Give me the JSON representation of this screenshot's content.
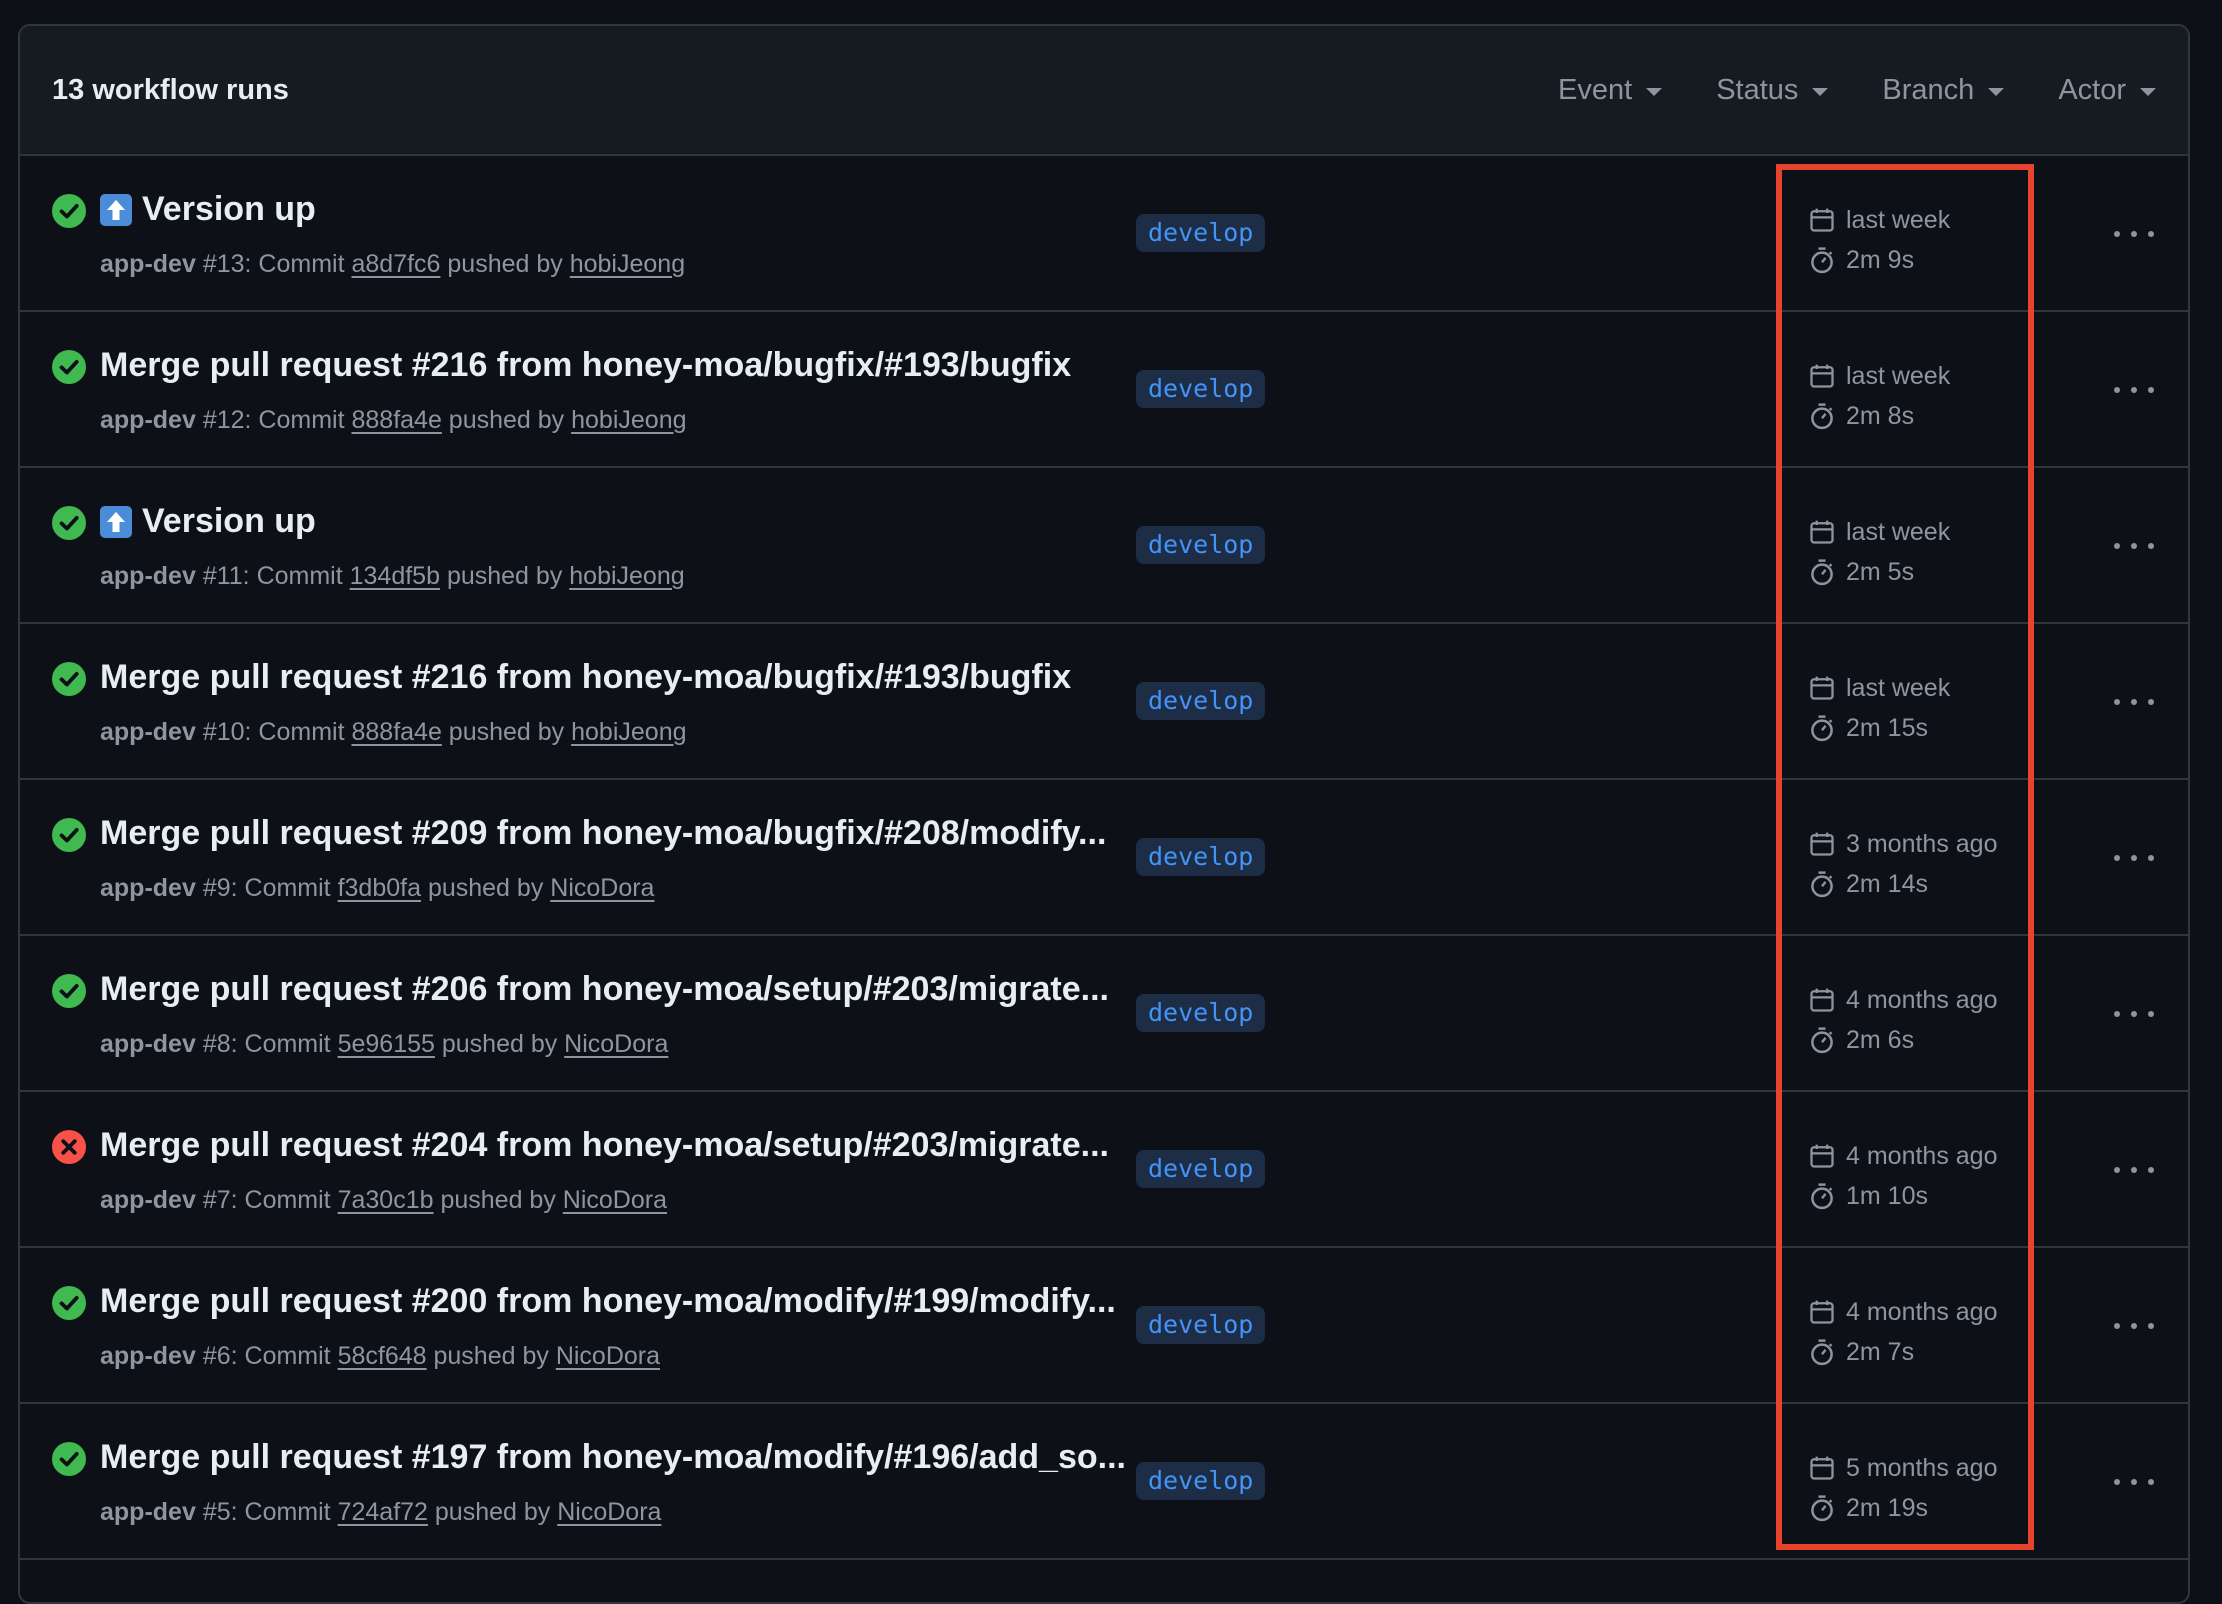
{
  "header": {
    "runs_count": "13 workflow runs",
    "filters": [
      "Event",
      "Status",
      "Branch",
      "Actor"
    ]
  },
  "colors": {
    "success": "#3fb950",
    "failure": "#f85149",
    "highlight": "#e8432c"
  },
  "runs": [
    {
      "status": "success",
      "emoji": "up-arrow-icon",
      "title": "Version up",
      "workflow": "app-dev",
      "number": "#13",
      "commit": "a8d7fc6",
      "actor": "hobiJeong",
      "branch": "develop",
      "date": "last week",
      "duration": "2m 9s"
    },
    {
      "status": "success",
      "emoji": "",
      "title": "Merge pull request #216 from honey-moa/bugfix/#193/bugfix",
      "workflow": "app-dev",
      "number": "#12",
      "commit": "888fa4e",
      "actor": "hobiJeong",
      "branch": "develop",
      "date": "last week",
      "duration": "2m 8s"
    },
    {
      "status": "success",
      "emoji": "up-arrow-icon",
      "title": "Version up",
      "workflow": "app-dev",
      "number": "#11",
      "commit": "134df5b",
      "actor": "hobiJeong",
      "branch": "develop",
      "date": "last week",
      "duration": "2m 5s"
    },
    {
      "status": "success",
      "emoji": "",
      "title": "Merge pull request #216 from honey-moa/bugfix/#193/bugfix",
      "workflow": "app-dev",
      "number": "#10",
      "commit": "888fa4e",
      "actor": "hobiJeong",
      "branch": "develop",
      "date": "last week",
      "duration": "2m 15s"
    },
    {
      "status": "success",
      "emoji": "",
      "title": "Merge pull request #209 from honey-moa/bugfix/#208/modify...",
      "workflow": "app-dev",
      "number": "#9",
      "commit": "f3db0fa",
      "actor": "NicoDora",
      "branch": "develop",
      "date": "3 months ago",
      "duration": "2m 14s"
    },
    {
      "status": "success",
      "emoji": "",
      "title": "Merge pull request #206 from honey-moa/setup/#203/migrate...",
      "workflow": "app-dev",
      "number": "#8",
      "commit": "5e96155",
      "actor": "NicoDora",
      "branch": "develop",
      "date": "4 months ago",
      "duration": "2m 6s"
    },
    {
      "status": "failure",
      "emoji": "",
      "title": "Merge pull request #204 from honey-moa/setup/#203/migrate...",
      "workflow": "app-dev",
      "number": "#7",
      "commit": "7a30c1b",
      "actor": "NicoDora",
      "branch": "develop",
      "date": "4 months ago",
      "duration": "1m 10s"
    },
    {
      "status": "success",
      "emoji": "",
      "title": "Merge pull request #200 from honey-moa/modify/#199/modify...",
      "workflow": "app-dev",
      "number": "#6",
      "commit": "58cf648",
      "actor": "NicoDora",
      "branch": "develop",
      "date": "4 months ago",
      "duration": "2m 7s"
    },
    {
      "status": "success",
      "emoji": "",
      "title": "Merge pull request #197 from honey-moa/modify/#196/add_so...",
      "workflow": "app-dev",
      "number": "#5",
      "commit": "724af72",
      "actor": "NicoDora",
      "branch": "develop",
      "date": "5 months ago",
      "duration": "2m 19s"
    }
  ]
}
